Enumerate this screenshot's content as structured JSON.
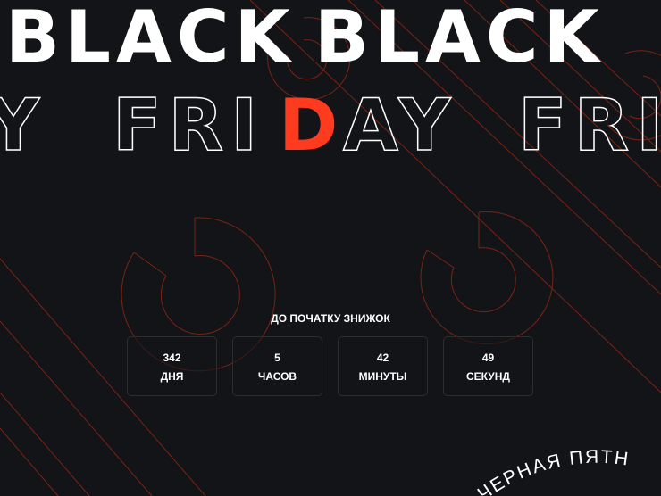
{
  "headline": {
    "line1_word1": "BLACK",
    "line1_word2": "BLACK",
    "line2_word1": "FRIDAY",
    "line2_word2": "FRI",
    "line2_left_fragment": "Y",
    "highlight_letter": "D"
  },
  "countdown": {
    "title": "ДО ПОЧАТКУ ЗНИЖОК",
    "boxes": [
      {
        "value": "342",
        "label": "ДНЯ"
      },
      {
        "value": "5",
        "label": "ЧАСОВ"
      },
      {
        "value": "42",
        "label": "МИНУТЫ"
      },
      {
        "value": "49",
        "label": "СЕКУНД"
      }
    ]
  },
  "badge": {
    "text": "ЧЕРНАЯ ПЯТН"
  },
  "colors": {
    "background": "#131417",
    "accent": "#ff3b1f",
    "line": "#7a2314",
    "text": "#ffffff",
    "box_border": "#2c2d31"
  }
}
